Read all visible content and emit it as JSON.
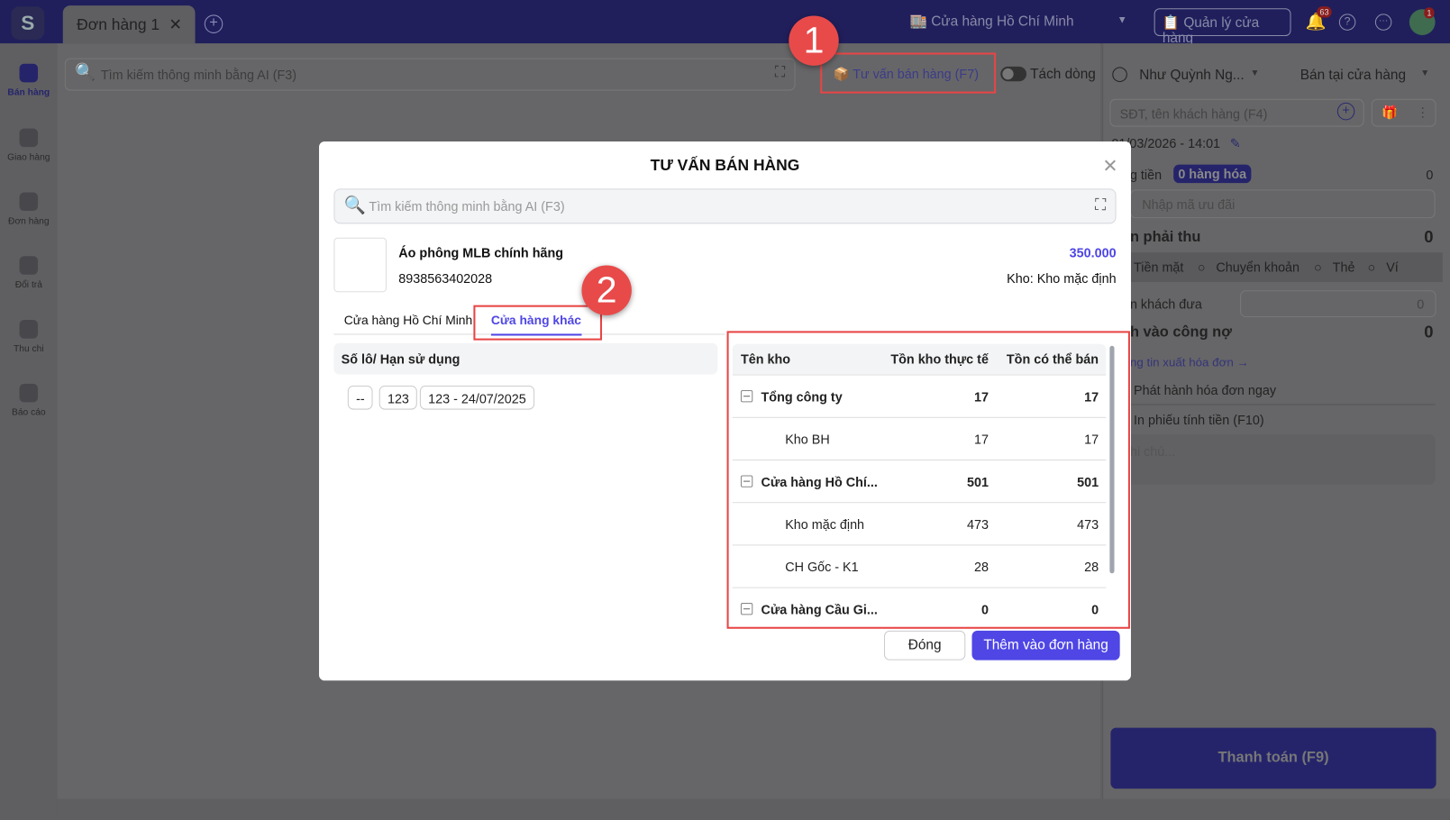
{
  "app": {
    "tab_label": "Đơn hàng",
    "tab_number": "1",
    "logo_text": "S",
    "store": "Cửa hàng Hồ Chí Minh",
    "manage_store": "Quản lý cửa hàng",
    "notifications_count": "63",
    "avatar_badge": "1"
  },
  "sidebar": {
    "items": [
      {
        "label": "Bán hàng",
        "active": true
      },
      {
        "label": "Giao hàng"
      },
      {
        "label": "Đơn hàng"
      },
      {
        "label": "Đổi trả"
      },
      {
        "label": "Thu chi"
      },
      {
        "label": "Báo cáo"
      }
    ]
  },
  "toolbar": {
    "search_placeholder": "Tìm kiếm thông minh bằng AI (F3)",
    "advise_label": "Tư vấn bán hàng (F7)",
    "split_label": "Tách dòng",
    "callout_1": "1",
    "callout_2": "2"
  },
  "right_panel": {
    "staff": "Như Quỳnh Ng...",
    "sale_type": "Bán tại cửa hàng",
    "customer_placeholder": "SĐT, tên khách hàng (F4)",
    "datetime": "01/03/2026 - 14:01",
    "total_label": "g tiền",
    "items_badge": "0 hàng hóa",
    "total_value": "0",
    "promo_placeholder": "Nhập mã ưu đãi",
    "due_label": "n phải thu",
    "due_value": "0",
    "payment_methods": [
      "Tiền mặt",
      "Chuyển khoản",
      "Thẻ",
      "Ví"
    ],
    "given_label": "n khách đưa",
    "given_value": "0",
    "debt_label": "h vào công nợ",
    "debt_value": "0",
    "invoice_link": "ng tin xuất hóa đơn →",
    "issue_invoice": "Phát hành hóa đơn ngay",
    "print_receipt": "In phiếu tính tiền (F10)",
    "note_placeholder": "hi chú...",
    "pay_button": "Thanh toán (F9)"
  },
  "modal": {
    "title": "TƯ VẤN BÁN HÀNG",
    "search_placeholder": "Tìm kiếm thông minh bằng AI (F3)",
    "product": {
      "name": "Áo phông MLB chính hãng",
      "code": "8938563402028",
      "price": "350.000",
      "warehouse": "Kho: Kho mặc định"
    },
    "tabs": [
      {
        "label": "Cửa hàng Hồ Chí Minh"
      },
      {
        "label": "Cửa hàng khác",
        "active": true
      }
    ],
    "lot_header": "Số lô/ Hạn sử dụng",
    "lots": [
      "--",
      "123",
      "123 - 24/07/2025"
    ],
    "table": {
      "headers": [
        "Tên kho",
        "Tồn kho thực tế",
        "Tồn có thể bán"
      ],
      "rows": [
        {
          "name": "Tổng công ty",
          "actual": "17",
          "sellable": "17",
          "group": true
        },
        {
          "name": "Kho BH",
          "actual": "17",
          "sellable": "17"
        },
        {
          "name": "Cửa hàng Hồ Chí...",
          "actual": "501",
          "sellable": "501",
          "group": true
        },
        {
          "name": "Kho mặc định",
          "actual": "473",
          "sellable": "473"
        },
        {
          "name": "CH Gốc - K1",
          "actual": "28",
          "sellable": "28"
        },
        {
          "name": "Cửa hàng Cầu Gi...",
          "actual": "0",
          "sellable": "0",
          "group": true
        }
      ]
    },
    "close_button": "Đóng",
    "add_button": "Thêm vào đơn hàng"
  },
  "colors": {
    "accent": "#4f46e5",
    "highlight": "#e84545",
    "topbar": "#201f5c"
  }
}
